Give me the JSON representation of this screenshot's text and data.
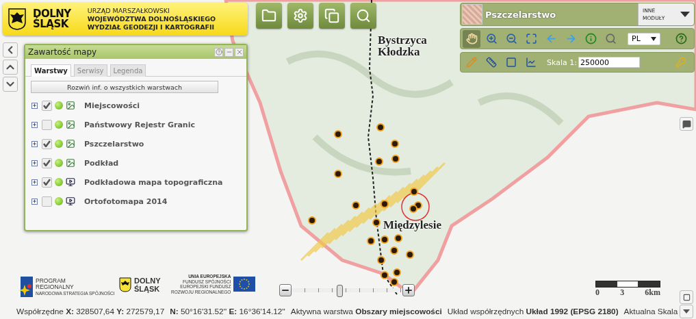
{
  "header": {
    "brand_lines": [
      "DOLNY",
      "ŚLĄSK"
    ],
    "office_lines": [
      "URZĄD MARSZAŁKOWSKI",
      "WOJEWÓDZTWA DOLNOŚLĄSKIEGO",
      "WYDZIAŁ GEODEZJI I KARTOGRAFII"
    ]
  },
  "main_buttons": [
    {
      "kind": "folder"
    },
    {
      "kind": "settings"
    },
    {
      "kind": "windows"
    },
    {
      "kind": "search"
    }
  ],
  "nav_buttons": [
    {
      "kind": "left"
    },
    {
      "kind": "up"
    },
    {
      "kind": "down"
    }
  ],
  "module_bar": {
    "title": "Pszczelarstwo",
    "menu_label": "INNE MODUŁY"
  },
  "tools": [
    {
      "kind": "pan",
      "selected": true
    },
    {
      "kind": "zoom-in",
      "selected": false
    },
    {
      "kind": "zoom-out",
      "selected": false
    },
    {
      "kind": "zoom-extent",
      "selected": false
    },
    {
      "kind": "back",
      "selected": false
    },
    {
      "kind": "forward",
      "selected": false
    },
    {
      "kind": "info",
      "selected": false
    },
    {
      "kind": "find",
      "selected": false
    }
  ],
  "language": {
    "value": "PL"
  },
  "measure_tools": [
    {
      "kind": "pencil"
    },
    {
      "kind": "length"
    },
    {
      "kind": "area"
    },
    {
      "kind": "profile"
    }
  ],
  "scale": {
    "label": "Skala 1:",
    "value": "250000"
  },
  "layer_panel": {
    "title": "Zawartość mapy",
    "tabs": [
      {
        "label": "Warstwy",
        "selected": true
      },
      {
        "label": "Serwisy",
        "selected": false
      },
      {
        "label": "Legenda",
        "selected": false
      }
    ],
    "expand_button": "Rozwiń inf. o wszystkich warstwach",
    "layers": [
      {
        "name": "Miejscowości",
        "checked": true,
        "kind": "vector"
      },
      {
        "name": "Państwowy Rejestr Granic",
        "checked": false,
        "kind": "vector"
      },
      {
        "name": "Pszczelarstwo",
        "checked": true,
        "kind": "vector"
      },
      {
        "name": "Podkład",
        "checked": true,
        "kind": "vector"
      },
      {
        "name": "Podkładowa mapa topograficzna",
        "checked": true,
        "kind": "service"
      },
      {
        "name": "Ortofotomapa 2014",
        "checked": false,
        "kind": "service"
      }
    ]
  },
  "map": {
    "labels": [
      {
        "text": "Bystrzyca Kłodzka"
      },
      {
        "text": "Międzylesie"
      }
    ]
  },
  "sponsors": {
    "program_lines": [
      "PROGRAM",
      "REGIONALNY"
    ],
    "program_sub": "NARODOWA STRATEGIA SPÓJNOŚCI",
    "region_lines": [
      "DOLNY",
      "ŚLĄSK"
    ],
    "eu_lines": [
      "UNIA EUROPEJSKA",
      "FUNDUSZ SPÓJNOŚCI",
      "EUROPEJSKI FUNDUSZ",
      "ROZWOJU REGIONALNEGO"
    ]
  },
  "zoom_slider": {
    "level": 0.43
  },
  "scale_bar": {
    "ticks": [
      "0",
      "3",
      "6km"
    ]
  },
  "status_bar": [
    {
      "text": "Współrzędne **X:** 328507,64 **Y:** 272579,17"
    },
    {
      "text": "**N:** 50°16'31.52'' **E:** 16°36'14.12''"
    },
    {
      "text": "Aktywna warstwa **Obszary miejscowości**"
    },
    {
      "text": "Układ współrzędnych **Układ 1992 (EPSG 2180)**"
    },
    {
      "text": "Aktualna Skala"
    }
  ]
}
